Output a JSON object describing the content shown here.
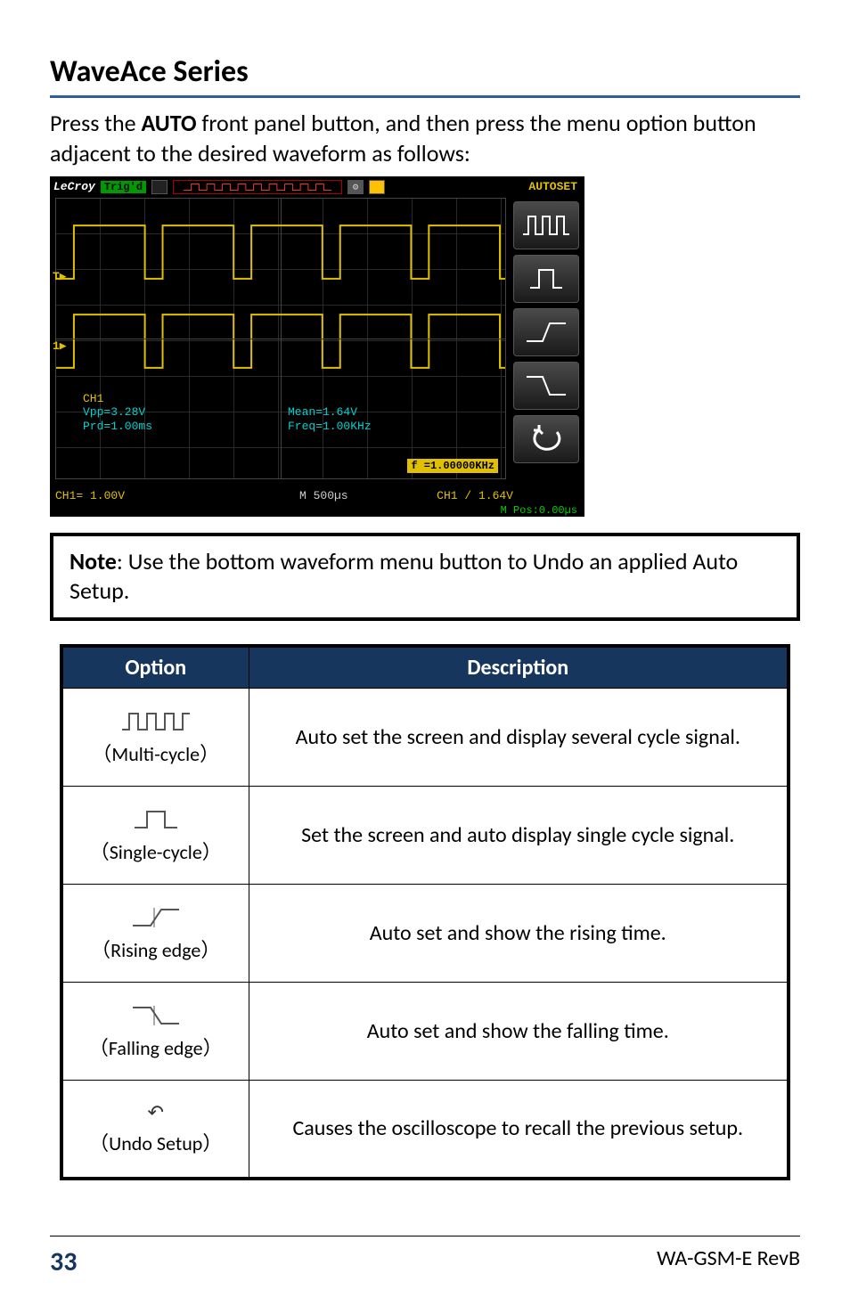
{
  "title": "WaveAce Series",
  "intro_pre": "Press the ",
  "intro_bold": "AUTO",
  "intro_post": " front panel button, and then press the menu option button adjacent to the desired waveform as follows:",
  "scope": {
    "brand": "LeCroy",
    "trig": "Trig'd",
    "autoset": "AUTOSET",
    "meas1_ch": "CH1",
    "meas1_l1": "Vpp=3.28V",
    "meas1_l2": "Prd=1.00ms",
    "meas2_l1": "Mean=1.64V",
    "meas2_l2": "Freq=1.00KHz",
    "freq_badge": "f =1.00000KHz",
    "bottom_ch1": "CH1= 1.00V",
    "bottom_m": "M 500µs",
    "bottom_trig": "CH1 / 1.64V",
    "bottom_pos": "M Pos:0.00µs",
    "t_marker": "T▶",
    "one_marker": "1▶"
  },
  "note_label": "Note",
  "note_text": ": Use the bottom waveform menu button to Undo an applied Auto Setup.",
  "table": {
    "h1": "Option",
    "h2": "Description",
    "rows": [
      {
        "label": "（Multi-cycle）",
        "desc": "Auto set the screen and display several cycle signal."
      },
      {
        "label": "（Single-cycle）",
        "desc": "Set the screen and auto display single cycle signal."
      },
      {
        "label": "（Rising edge）",
        "desc": "Auto set and show the rising time."
      },
      {
        "label": "（Falling edge）",
        "desc": "Auto set and show the falling time."
      },
      {
        "label": "（Undo Setup）",
        "desc": "Causes the oscilloscope to recall the previous setup."
      }
    ]
  },
  "footer": {
    "page": "33",
    "doc": "WA-GSM-E RevB"
  }
}
